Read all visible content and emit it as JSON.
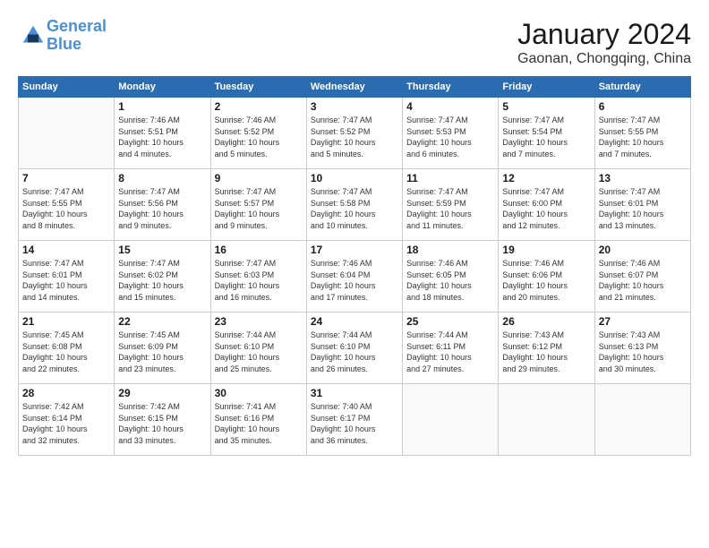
{
  "logo": {
    "line1": "General",
    "line2": "Blue"
  },
  "title": "January 2024",
  "subtitle": "Gaonan, Chongqing, China",
  "days_of_week": [
    "Sunday",
    "Monday",
    "Tuesday",
    "Wednesday",
    "Thursday",
    "Friday",
    "Saturday"
  ],
  "weeks": [
    [
      {
        "day": "",
        "info": ""
      },
      {
        "day": "1",
        "info": "Sunrise: 7:46 AM\nSunset: 5:51 PM\nDaylight: 10 hours\nand 4 minutes."
      },
      {
        "day": "2",
        "info": "Sunrise: 7:46 AM\nSunset: 5:52 PM\nDaylight: 10 hours\nand 5 minutes."
      },
      {
        "day": "3",
        "info": "Sunrise: 7:47 AM\nSunset: 5:52 PM\nDaylight: 10 hours\nand 5 minutes."
      },
      {
        "day": "4",
        "info": "Sunrise: 7:47 AM\nSunset: 5:53 PM\nDaylight: 10 hours\nand 6 minutes."
      },
      {
        "day": "5",
        "info": "Sunrise: 7:47 AM\nSunset: 5:54 PM\nDaylight: 10 hours\nand 7 minutes."
      },
      {
        "day": "6",
        "info": "Sunrise: 7:47 AM\nSunset: 5:55 PM\nDaylight: 10 hours\nand 7 minutes."
      }
    ],
    [
      {
        "day": "7",
        "info": "Sunrise: 7:47 AM\nSunset: 5:55 PM\nDaylight: 10 hours\nand 8 minutes."
      },
      {
        "day": "8",
        "info": "Sunrise: 7:47 AM\nSunset: 5:56 PM\nDaylight: 10 hours\nand 9 minutes."
      },
      {
        "day": "9",
        "info": "Sunrise: 7:47 AM\nSunset: 5:57 PM\nDaylight: 10 hours\nand 9 minutes."
      },
      {
        "day": "10",
        "info": "Sunrise: 7:47 AM\nSunset: 5:58 PM\nDaylight: 10 hours\nand 10 minutes."
      },
      {
        "day": "11",
        "info": "Sunrise: 7:47 AM\nSunset: 5:59 PM\nDaylight: 10 hours\nand 11 minutes."
      },
      {
        "day": "12",
        "info": "Sunrise: 7:47 AM\nSunset: 6:00 PM\nDaylight: 10 hours\nand 12 minutes."
      },
      {
        "day": "13",
        "info": "Sunrise: 7:47 AM\nSunset: 6:01 PM\nDaylight: 10 hours\nand 13 minutes."
      }
    ],
    [
      {
        "day": "14",
        "info": "Sunrise: 7:47 AM\nSunset: 6:01 PM\nDaylight: 10 hours\nand 14 minutes."
      },
      {
        "day": "15",
        "info": "Sunrise: 7:47 AM\nSunset: 6:02 PM\nDaylight: 10 hours\nand 15 minutes."
      },
      {
        "day": "16",
        "info": "Sunrise: 7:47 AM\nSunset: 6:03 PM\nDaylight: 10 hours\nand 16 minutes."
      },
      {
        "day": "17",
        "info": "Sunrise: 7:46 AM\nSunset: 6:04 PM\nDaylight: 10 hours\nand 17 minutes."
      },
      {
        "day": "18",
        "info": "Sunrise: 7:46 AM\nSunset: 6:05 PM\nDaylight: 10 hours\nand 18 minutes."
      },
      {
        "day": "19",
        "info": "Sunrise: 7:46 AM\nSunset: 6:06 PM\nDaylight: 10 hours\nand 20 minutes."
      },
      {
        "day": "20",
        "info": "Sunrise: 7:46 AM\nSunset: 6:07 PM\nDaylight: 10 hours\nand 21 minutes."
      }
    ],
    [
      {
        "day": "21",
        "info": "Sunrise: 7:45 AM\nSunset: 6:08 PM\nDaylight: 10 hours\nand 22 minutes."
      },
      {
        "day": "22",
        "info": "Sunrise: 7:45 AM\nSunset: 6:09 PM\nDaylight: 10 hours\nand 23 minutes."
      },
      {
        "day": "23",
        "info": "Sunrise: 7:44 AM\nSunset: 6:10 PM\nDaylight: 10 hours\nand 25 minutes."
      },
      {
        "day": "24",
        "info": "Sunrise: 7:44 AM\nSunset: 6:10 PM\nDaylight: 10 hours\nand 26 minutes."
      },
      {
        "day": "25",
        "info": "Sunrise: 7:44 AM\nSunset: 6:11 PM\nDaylight: 10 hours\nand 27 minutes."
      },
      {
        "day": "26",
        "info": "Sunrise: 7:43 AM\nSunset: 6:12 PM\nDaylight: 10 hours\nand 29 minutes."
      },
      {
        "day": "27",
        "info": "Sunrise: 7:43 AM\nSunset: 6:13 PM\nDaylight: 10 hours\nand 30 minutes."
      }
    ],
    [
      {
        "day": "28",
        "info": "Sunrise: 7:42 AM\nSunset: 6:14 PM\nDaylight: 10 hours\nand 32 minutes."
      },
      {
        "day": "29",
        "info": "Sunrise: 7:42 AM\nSunset: 6:15 PM\nDaylight: 10 hours\nand 33 minutes."
      },
      {
        "day": "30",
        "info": "Sunrise: 7:41 AM\nSunset: 6:16 PM\nDaylight: 10 hours\nand 35 minutes."
      },
      {
        "day": "31",
        "info": "Sunrise: 7:40 AM\nSunset: 6:17 PM\nDaylight: 10 hours\nand 36 minutes."
      },
      {
        "day": "",
        "info": ""
      },
      {
        "day": "",
        "info": ""
      },
      {
        "day": "",
        "info": ""
      }
    ]
  ]
}
